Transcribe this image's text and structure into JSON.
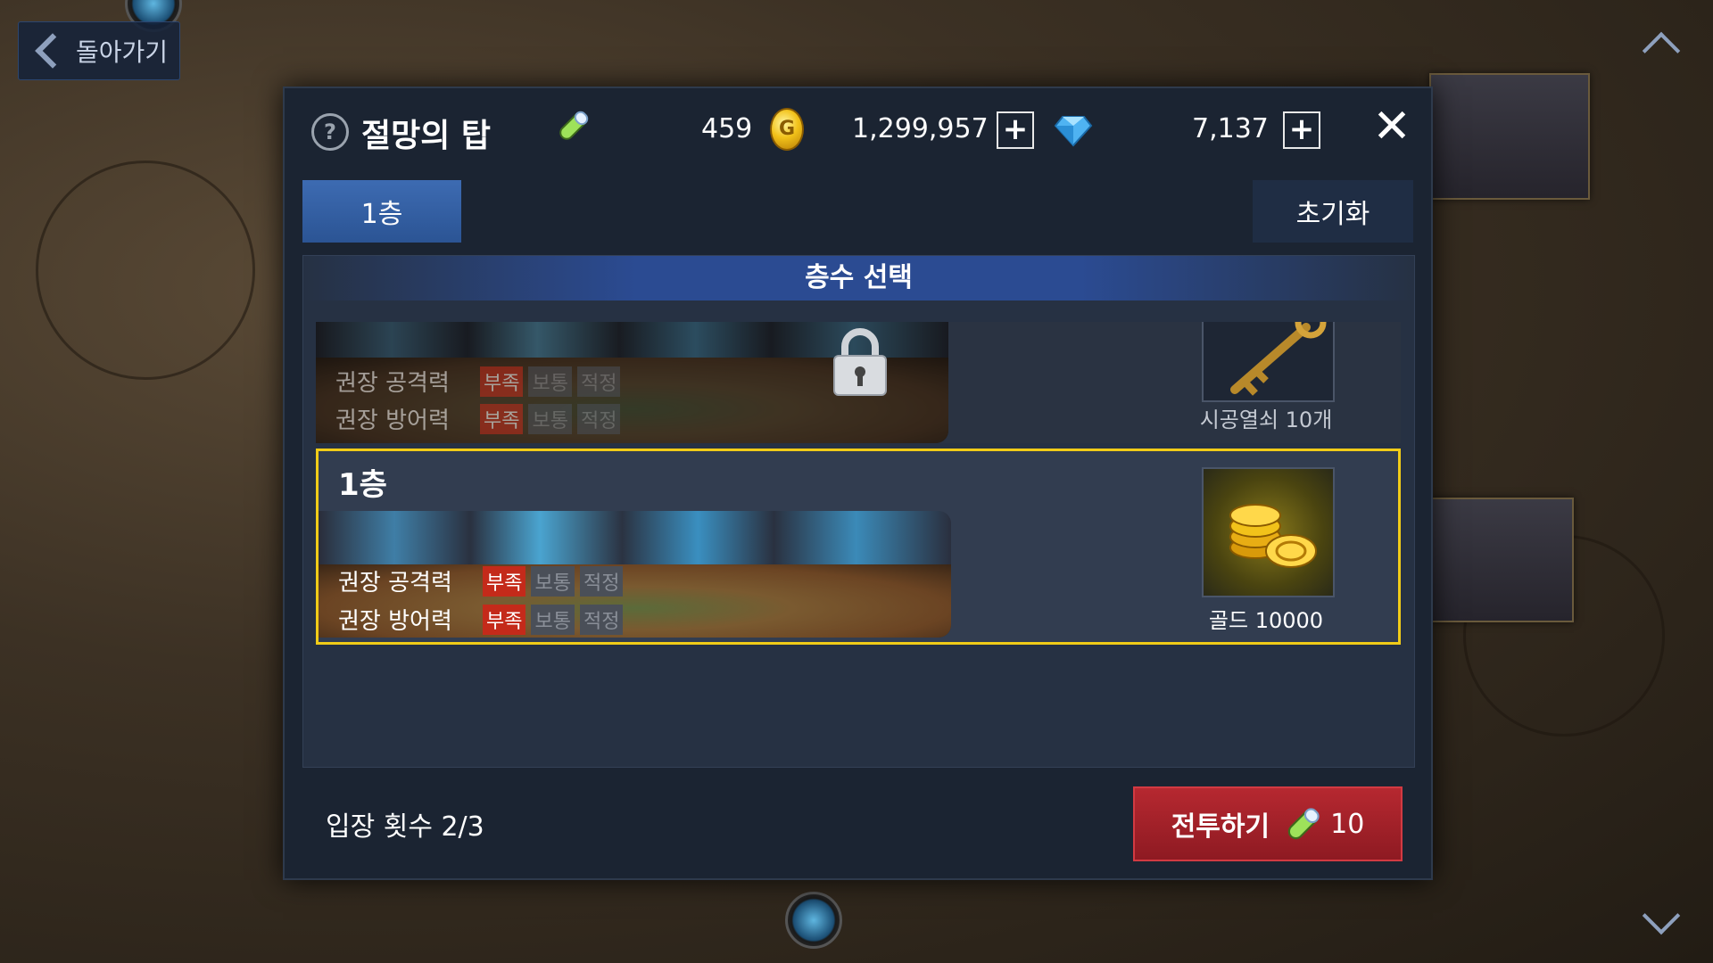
{
  "back_button": {
    "label": "돌아가기"
  },
  "modal": {
    "title": "절망의 탑",
    "stamina": "459",
    "gold": "1,299,957",
    "gems": "7,137",
    "plus_label": "+",
    "close_label": "✕",
    "help_label": "?"
  },
  "tabs": {
    "floor": "1층",
    "reset": "초기화"
  },
  "list": {
    "header": "층수 선택",
    "locked_floor": {
      "stat_attack": "권장 공격력",
      "stat_defense": "권장 방어력",
      "reward": "시공열쇠 10개",
      "reward_icon": "key-icon",
      "levels": [
        "부족",
        "보통",
        "적정"
      ]
    },
    "current_floor": {
      "name": "1층",
      "stat_attack": "권장 공격력",
      "stat_defense": "권장 방어력",
      "reward": "골드 10000",
      "reward_icon": "gold-coins-icon",
      "levels": [
        "부족",
        "보통",
        "적정"
      ]
    }
  },
  "footer": {
    "entry_count": "입장 횟수 2/3",
    "battle_label": "전투하기",
    "battle_cost": "10"
  },
  "colors": {
    "accent_blue": "#2b5494",
    "battle_red": "#b62830",
    "selection_yellow": "#f1cc18"
  }
}
